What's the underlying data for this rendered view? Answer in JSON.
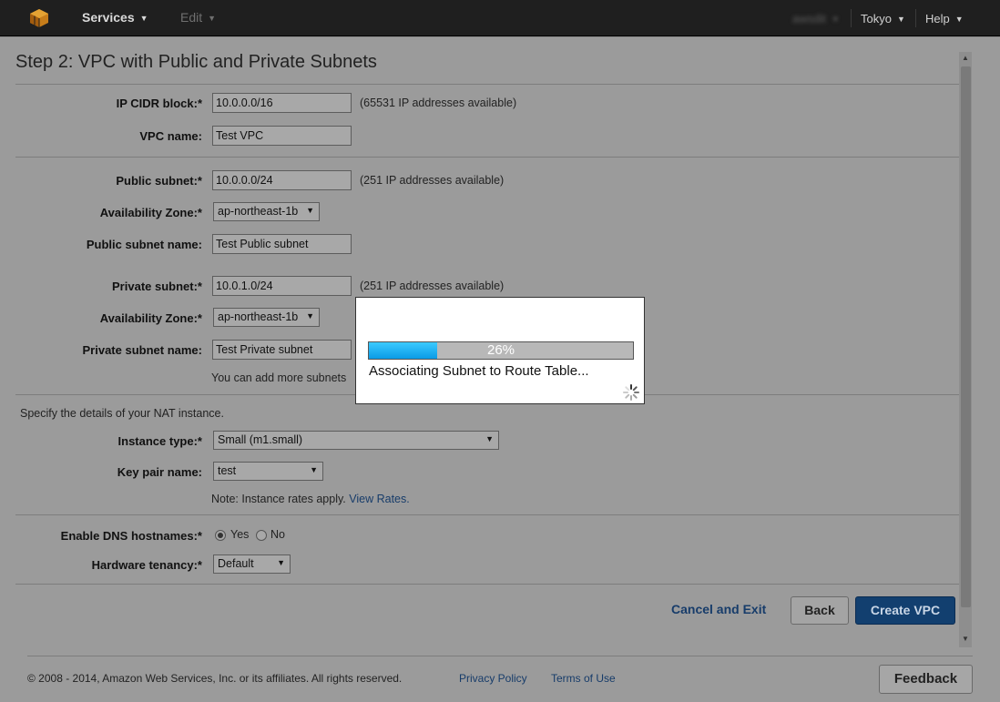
{
  "topnav": {
    "services_label": "Services",
    "edit_label": "Edit",
    "user_label": "awsdit",
    "region_label": "Tokyo",
    "help_label": "Help"
  },
  "page": {
    "title": "Step 2: VPC with Public and Private Subnets"
  },
  "vpc": {
    "cidr_label": "IP CIDR block:*",
    "cidr_value": "10.0.0.0/16",
    "cidr_note": "(65531 IP addresses available)",
    "name_label": "VPC name:",
    "name_value": "Test VPC"
  },
  "public_subnet": {
    "cidr_label": "Public subnet:*",
    "cidr_value": "10.0.0.0/24",
    "cidr_note": "(251 IP addresses available)",
    "az_label": "Availability Zone:*",
    "az_value": "ap-northeast-1b",
    "name_label": "Public subnet name:",
    "name_value": "Test Public subnet"
  },
  "private_subnet": {
    "cidr_label": "Private subnet:*",
    "cidr_value": "10.0.1.0/24",
    "cidr_note": "(251 IP addresses available)",
    "az_label": "Availability Zone:*",
    "az_value": "ap-northeast-1b",
    "name_label": "Private subnet name:",
    "name_value": "Test Private subnet",
    "more_note": "You can add more subnets"
  },
  "nat": {
    "intro": "Specify the details of your NAT instance.",
    "instance_type_label": "Instance type:*",
    "instance_type_value": "Small (m1.small)",
    "key_pair_label": "Key pair name:",
    "key_pair_value": "test",
    "rates_note": "Note: Instance rates apply.",
    "rates_link": "View Rates."
  },
  "options": {
    "dns_label": "Enable DNS hostnames:*",
    "dns_yes": "Yes",
    "dns_no": "No",
    "tenancy_label": "Hardware tenancy:*",
    "tenancy_value": "Default"
  },
  "actions": {
    "cancel": "Cancel and Exit",
    "back": "Back",
    "create": "Create VPC"
  },
  "footer": {
    "copyright": "© 2008 - 2014, Amazon Web Services, Inc. or its affiliates. All rights reserved.",
    "privacy": "Privacy Policy",
    "terms": "Terms of Use",
    "feedback": "Feedback"
  },
  "progress_dialog": {
    "percent": 26,
    "percent_label": "26%",
    "message": "Associating Subnet to Route Table..."
  },
  "colors": {
    "link": "#173c6a",
    "progress_fill": "#0a9be6",
    "primary_button": "#123f6f"
  }
}
